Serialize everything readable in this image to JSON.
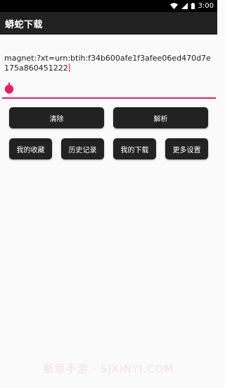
{
  "status_bar": {
    "time": "3:00"
  },
  "app_bar": {
    "title": "蟒蛇下载"
  },
  "magnet_input": {
    "value": "magnet:?xt=urn:btih:f34b600afe1f3afee06ed470d7e175a860451222"
  },
  "buttons": {
    "clear": "清除",
    "parse": "解析",
    "favorites": "我的收藏",
    "history": "历史记录",
    "downloads": "我的下载",
    "more_settings": "更多设置"
  },
  "watermark": {
    "text": "新意手游 · SJXINYI.COM"
  },
  "colors": {
    "accent": "#e91e63",
    "toolbar": "#212121",
    "button": "#222222"
  }
}
